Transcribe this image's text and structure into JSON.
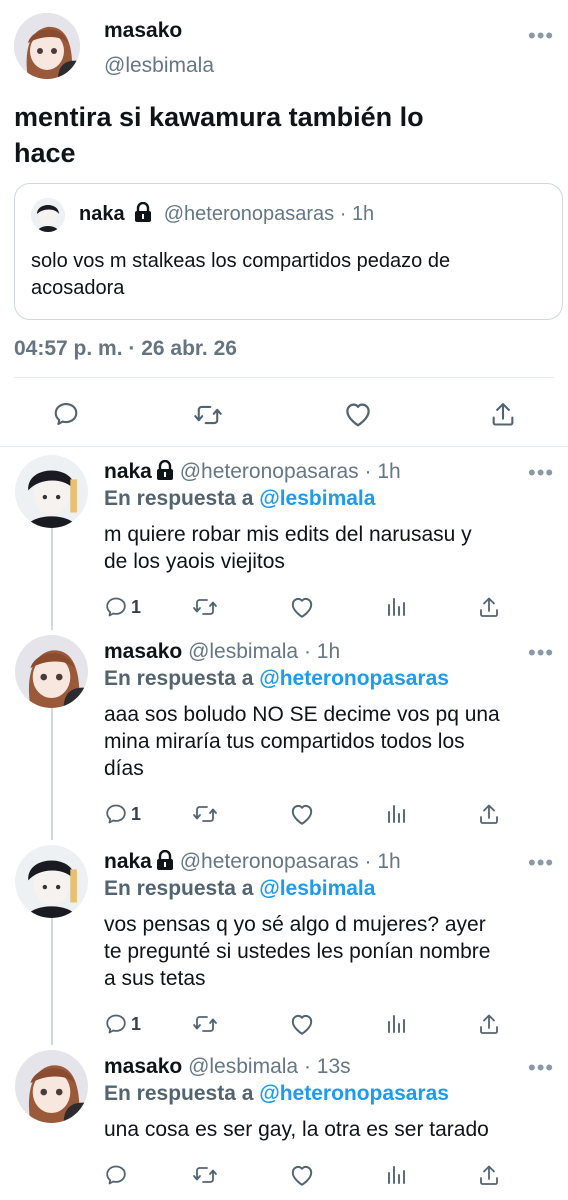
{
  "main_tweet": {
    "display_name": "masako",
    "handle": "@lesbimala",
    "text_line1": "mentira si kawamura también lo",
    "text_line2": "hace",
    "quoted": {
      "display_name": "naka",
      "handle": "@heteronopasaras",
      "sep": "·",
      "time": "1h",
      "text_line1": "solo vos m stalkeas los compartidos pedazo de",
      "text_line2": "acosadora"
    },
    "timestamp": "04:57 p. m. · 26 abr. 26"
  },
  "replies": [
    {
      "display_name": "naka",
      "locked": true,
      "handle": "@heteronopasaras",
      "time": "1h",
      "reply_prefix": "En respuesta a",
      "reply_to": "@lesbimala",
      "lines": [
        "m quiere robar mis edits del narusasu y",
        "de los yaois viejitos"
      ],
      "reply_count": "1",
      "avatar_color": "naka"
    },
    {
      "display_name": "masako",
      "locked": false,
      "handle": "@lesbimala",
      "time": "1h",
      "reply_prefix": "En respuesta a",
      "reply_to": "@heteronopasaras",
      "lines": [
        "aaa sos boludo NO SE decime vos pq una",
        "mina miraría tus compartidos todos los",
        "días"
      ],
      "reply_count": "1",
      "avatar_color": "masako"
    },
    {
      "display_name": "naka",
      "locked": true,
      "handle": "@heteronopasaras",
      "time": "1h",
      "reply_prefix": "En respuesta a",
      "reply_to": "@lesbimala",
      "lines": [
        "vos pensas q yo sé algo d mujeres? ayer",
        "te pregunté si ustedes les ponían nombre",
        "a sus tetas"
      ],
      "reply_count": "1",
      "avatar_color": "naka"
    },
    {
      "display_name": "masako",
      "locked": false,
      "handle": "@lesbimala",
      "time": "13s",
      "reply_prefix": "En respuesta a",
      "reply_to": "@heteronopasaras",
      "lines": [
        "una cosa es ser gay, la otra es ser tarado"
      ],
      "reply_count": "",
      "avatar_color": "masako"
    }
  ],
  "separator": "·",
  "colors": {
    "link": "#1d9bf0",
    "secondary": "#657786",
    "divider": "#e6ecf0"
  }
}
